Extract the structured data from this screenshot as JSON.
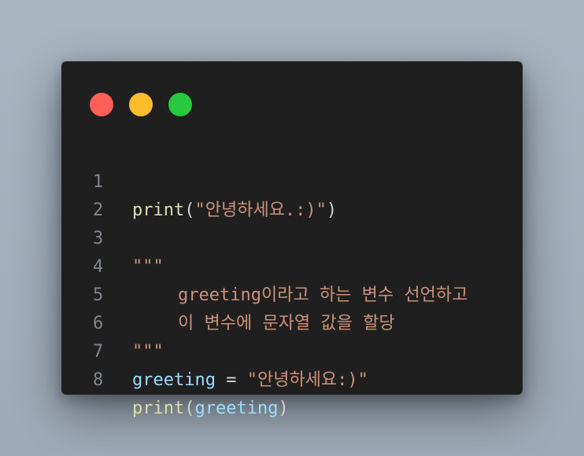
{
  "window": {
    "buttons": [
      {
        "name": "close",
        "color": "#ff5f56"
      },
      {
        "name": "minimize",
        "color": "#ffbd2e"
      },
      {
        "name": "maximize",
        "color": "#27c93f"
      }
    ]
  },
  "code": {
    "lines": [
      {
        "number": "1",
        "fn": "print",
        "open": "(",
        "str": "\"안녕하세요.:)\"",
        "close": ")"
      },
      {
        "number": "2"
      },
      {
        "number": "3",
        "str": "\"\"\""
      },
      {
        "number": "4",
        "str": "greeting이라고 하는 변수 선언하고"
      },
      {
        "number": "5",
        "str": "이 변수에 문자열 값을 할당"
      },
      {
        "number": "6",
        "str": "\"\"\""
      },
      {
        "number": "7",
        "var": "greeting",
        "op": " = ",
        "str": "\"안녕하세요:)\""
      },
      {
        "number": "8",
        "fn": "print",
        "open": "(",
        "var": "greeting",
        "close": ")"
      }
    ]
  },
  "colors": {
    "background": "#1f1f1f",
    "function": "#dcdcaa",
    "string": "#ce9178",
    "variable": "#9cdcfe",
    "punctuation": "#d4d4d4",
    "line_number": "#7f8690"
  }
}
